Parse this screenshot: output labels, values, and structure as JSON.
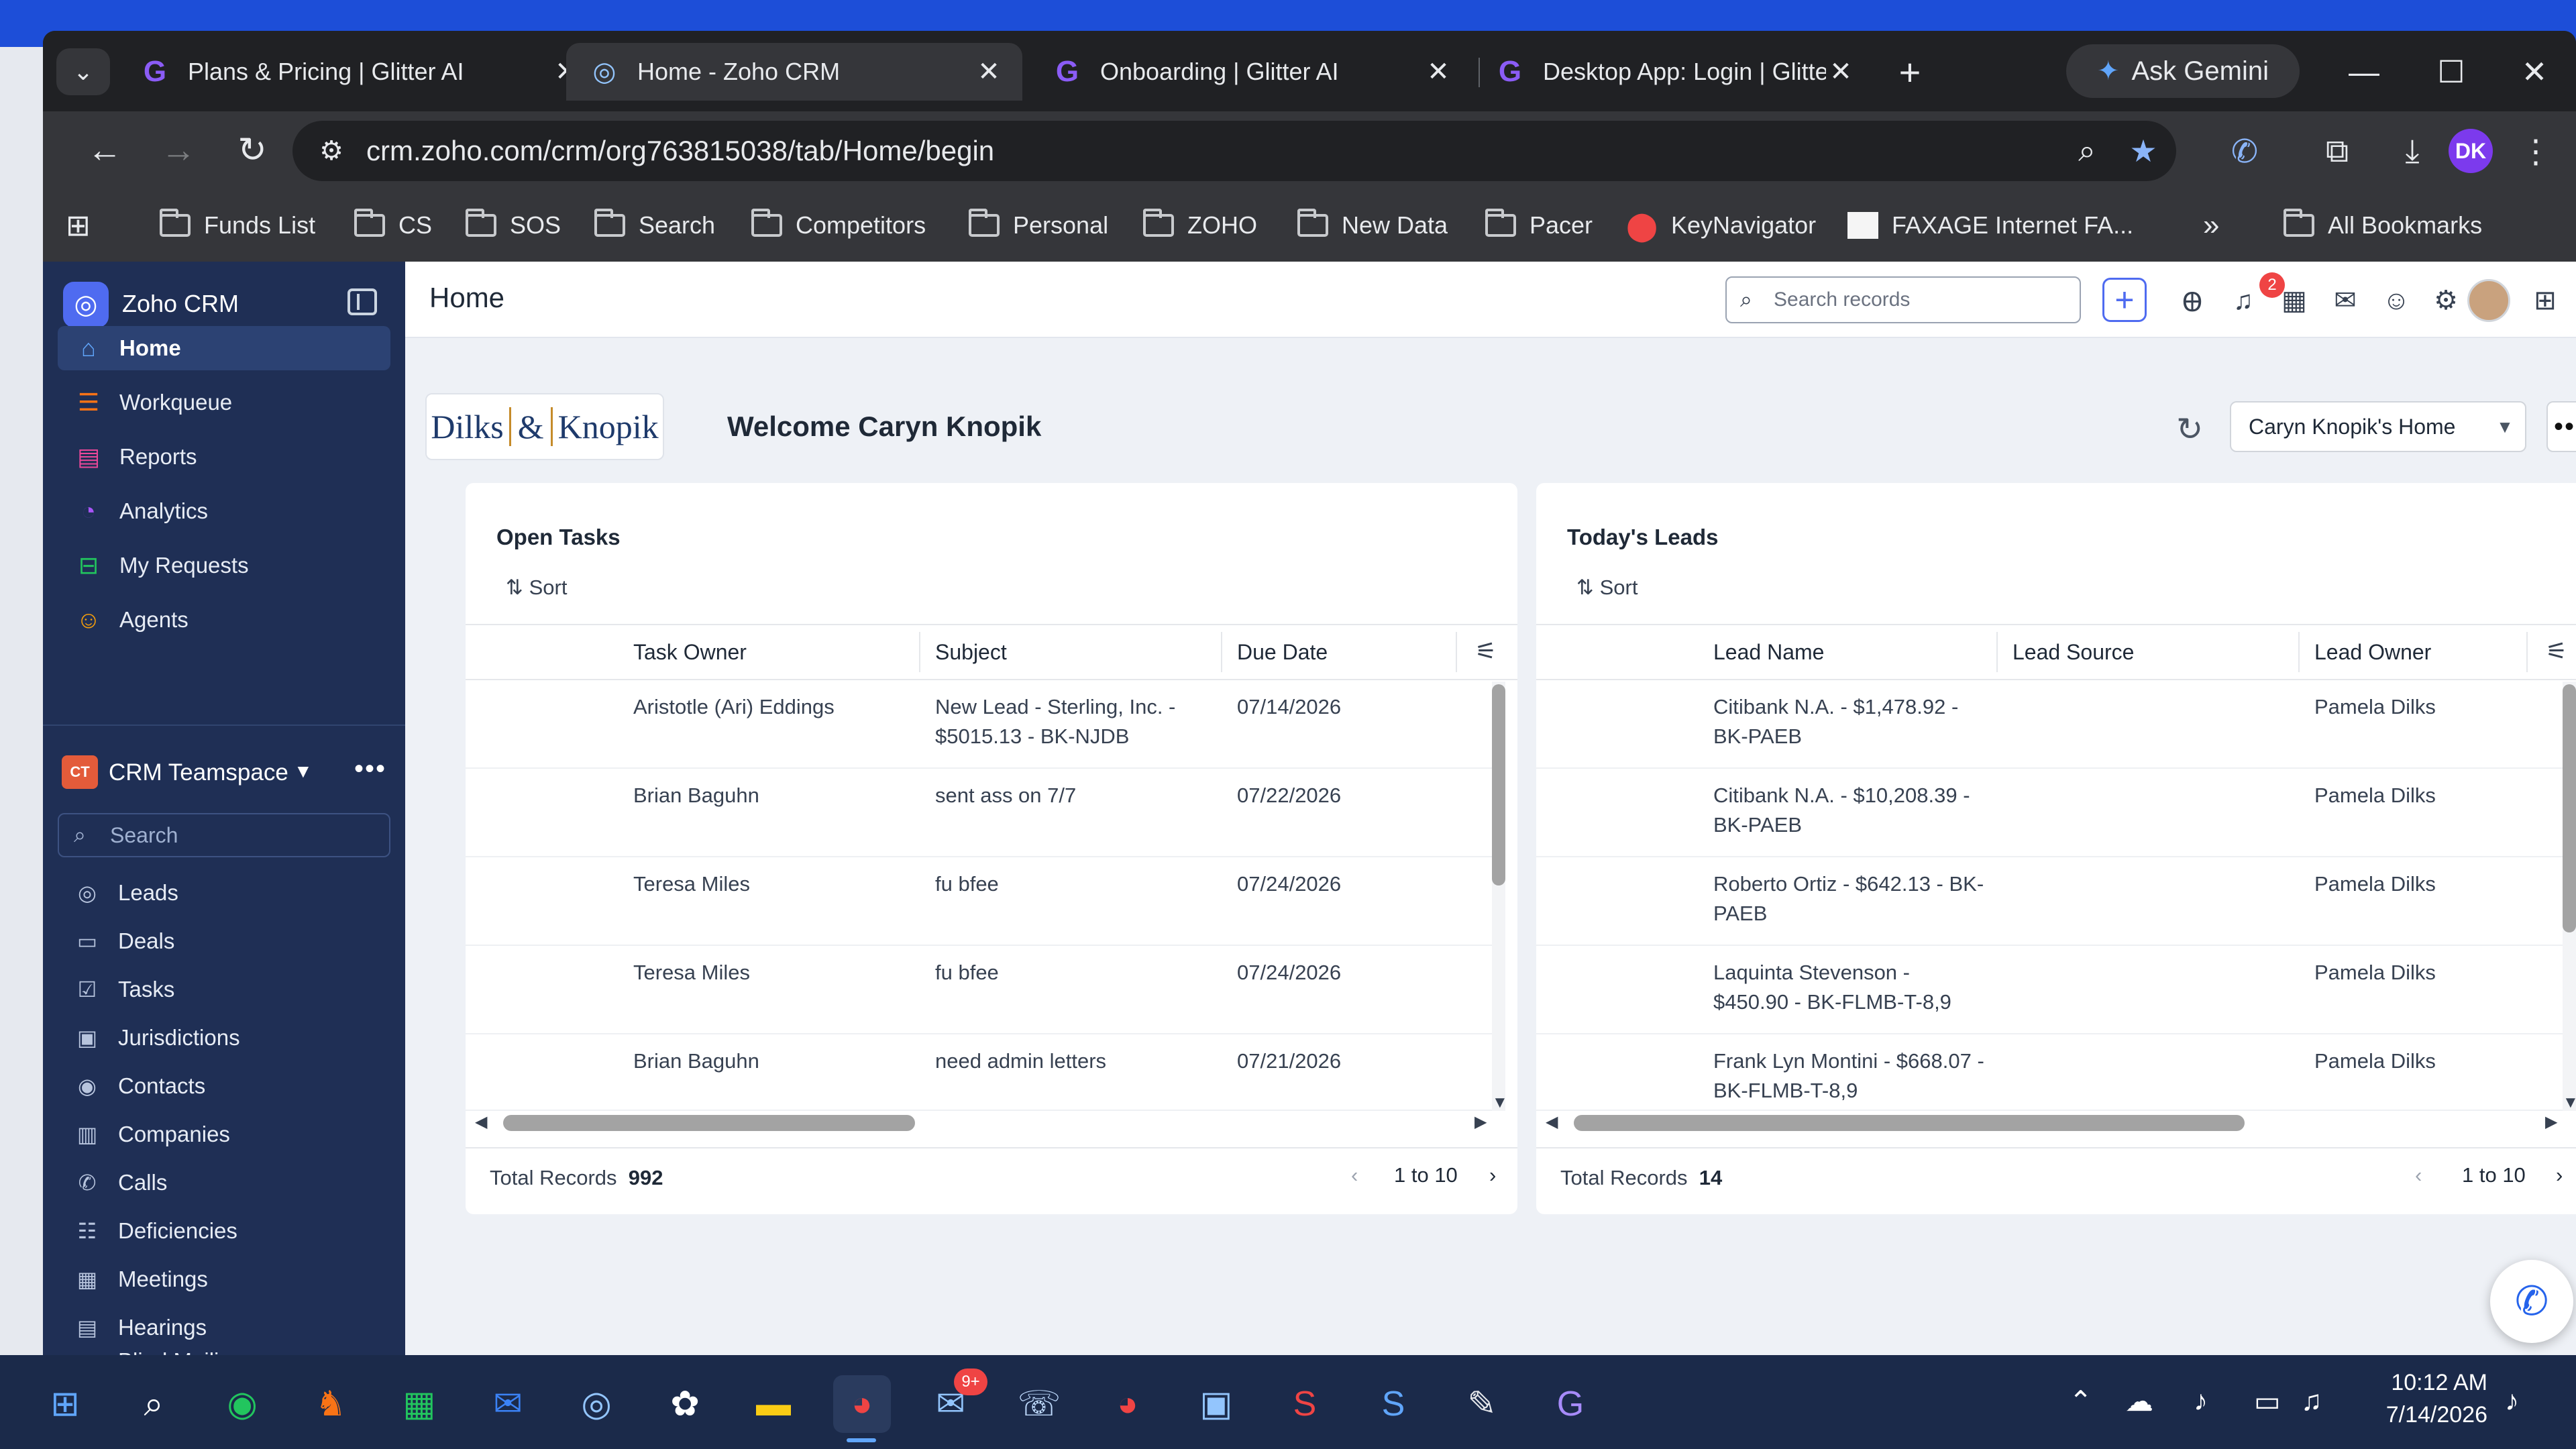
{
  "browser": {
    "tabs": [
      {
        "title": "Plans & Pricing | Glitter AI",
        "favicon": "glitter-icon",
        "active": false
      },
      {
        "title": "Home - Zoho CRM",
        "favicon": "zoho-icon",
        "active": true
      },
      {
        "title": "Onboarding | Glitter AI",
        "favicon": "glitter-icon",
        "active": false
      },
      {
        "title": "Desktop App: Login | Glitter",
        "favicon": "glitter-icon",
        "active": false
      }
    ],
    "ask_gemini": "Ask Gemini",
    "url": "crm.zoho.com/crm/org763815038/tab/Home/begin",
    "profile_initials": "DK",
    "bookmarks": [
      "Funds List",
      "CS",
      "SOS",
      "Search",
      "Competitors",
      "Personal",
      "ZOHO",
      "New Data",
      "Pacer",
      "KeyNavigator",
      "FAXAGE Internet FA..."
    ],
    "all_bookmarks": "All Bookmarks"
  },
  "sidebar": {
    "app_name": "Zoho CRM",
    "items": [
      {
        "label": "Home",
        "icon": "home-icon",
        "color": "#60a5fa",
        "active": true
      },
      {
        "label": "Workqueue",
        "icon": "workqueue-icon",
        "color": "#f97316",
        "active": false
      },
      {
        "label": "Reports",
        "icon": "reports-icon",
        "color": "#ec4899",
        "active": false
      },
      {
        "label": "Analytics",
        "icon": "analytics-icon",
        "color": "#a855f7",
        "active": false
      },
      {
        "label": "My Requests",
        "icon": "requests-icon",
        "color": "#22c55e",
        "active": false
      },
      {
        "label": "Agents",
        "icon": "agents-icon",
        "color": "#f59e0b",
        "active": false
      }
    ],
    "teamspace": {
      "badge": "CT",
      "name": "CRM Teamspace"
    },
    "search_placeholder": "Search",
    "modules": [
      "Leads",
      "Deals",
      "Tasks",
      "Jurisdictions",
      "Contacts",
      "Companies",
      "Calls",
      "Deficiencies",
      "Meetings",
      "Hearings",
      "Blind Mailings"
    ]
  },
  "header": {
    "title": "Home",
    "search_placeholder": "Search records",
    "notification_count": "2"
  },
  "home": {
    "logo": {
      "left": "Dilks",
      "amp": "&",
      "right": "Knopik"
    },
    "welcome": "Welcome Caryn Knopik",
    "view_select": "Caryn Knopik's Home"
  },
  "open_tasks": {
    "title": "Open Tasks",
    "sort_label": "Sort",
    "columns": [
      "Task Owner",
      "Subject",
      "Due Date"
    ],
    "rows": [
      {
        "owner": "Aristotle (Ari) Eddings",
        "subject": "New Lead - Sterling, Inc. - $5015.13 - BK-NJDB",
        "due": "07/14/2026"
      },
      {
        "owner": "Brian Baguhn",
        "subject": "sent ass on 7/7",
        "due": "07/22/2026"
      },
      {
        "owner": "Teresa Miles",
        "subject": "fu bfee",
        "due": "07/24/2026"
      },
      {
        "owner": "Teresa Miles",
        "subject": "fu bfee",
        "due": "07/24/2026"
      },
      {
        "owner": "Brian Baguhn",
        "subject": "need admin letters",
        "due": "07/21/2026"
      }
    ],
    "total_label": "Total Records",
    "total_count": "992",
    "page_range": "1 to 10"
  },
  "todays_leads": {
    "title": "Today's Leads",
    "sort_label": "Sort",
    "columns": [
      "Lead Name",
      "Lead Source",
      "Lead Owner"
    ],
    "rows": [
      {
        "name": "Citibank N.A. - $1,478.92 - BK-PAEB",
        "source": "",
        "owner": "Pamela Dilks"
      },
      {
        "name": "Citibank N.A. - $10,208.39 - BK-PAEB",
        "source": "",
        "owner": "Pamela Dilks"
      },
      {
        "name": "Roberto Ortiz - $642.13 - BK-PAEB",
        "source": "",
        "owner": "Pamela Dilks"
      },
      {
        "name": "Laquinta Stevenson - $450.90 - BK-FLMB-T-8,9",
        "source": "",
        "owner": "Pamela Dilks"
      },
      {
        "name": "Frank Lyn Montini - $668.07 - BK-FLMB-T-8,9",
        "source": "",
        "owner": "Pamela Dilks"
      }
    ],
    "total_label": "Total Records",
    "total_count": "14",
    "page_range": "1 to 10"
  },
  "taskbar": {
    "time": "10:12 AM",
    "date": "7/14/2026",
    "mail_badge": "9+"
  }
}
